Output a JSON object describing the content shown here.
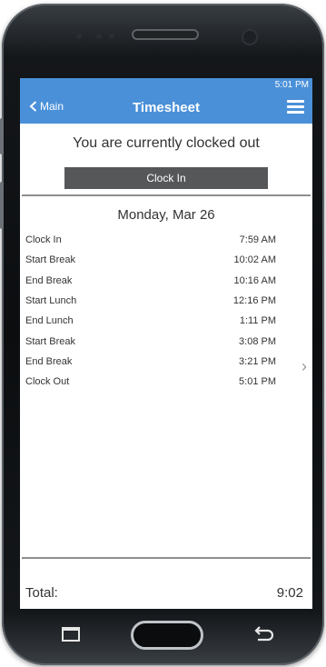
{
  "status_bar": {
    "time": "5:01 PM"
  },
  "nav": {
    "back_label": "Main",
    "title": "Timesheet"
  },
  "status_text": "You are currently clocked out",
  "clock_in_button": "Clock In",
  "day_header": "Monday, Mar 26",
  "entries": [
    {
      "label": "Clock In",
      "time": "7:59 AM"
    },
    {
      "label": "Start Break",
      "time": "10:02 AM"
    },
    {
      "label": "End Break",
      "time": "10:16 AM"
    },
    {
      "label": "Start Lunch",
      "time": "12:16 PM"
    },
    {
      "label": "End Lunch",
      "time": "1:11 PM"
    },
    {
      "label": "Start Break",
      "time": "3:08 PM"
    },
    {
      "label": "End Break",
      "time": "3:21 PM"
    },
    {
      "label": "Clock Out",
      "time": "5:01 PM"
    }
  ],
  "total": {
    "label": "Total:",
    "value": "9:02"
  },
  "colors": {
    "accent": "#4a90d9",
    "button": "#555759"
  },
  "icons": {
    "back": "chevron-left-icon",
    "menu": "hamburger-menu-icon",
    "detail": "chevron-right-icon"
  }
}
